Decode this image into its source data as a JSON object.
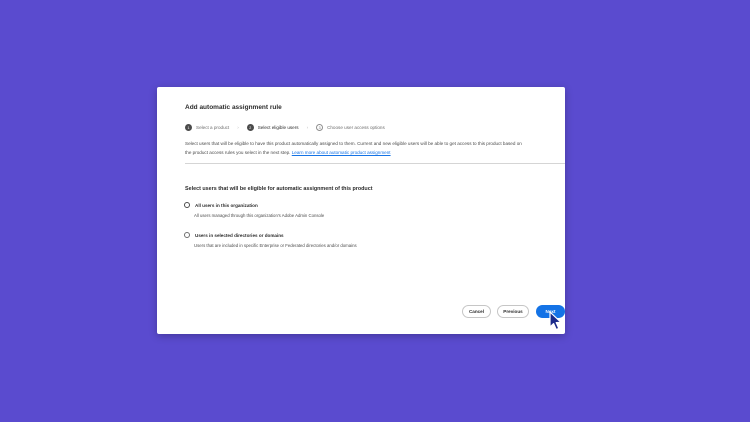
{
  "dialog": {
    "title": "Add automatic assignment rule",
    "steps": [
      {
        "number": "1",
        "label": "Select a product"
      },
      {
        "number": "2",
        "label": "Select eligible users"
      },
      {
        "number": "3",
        "label": "Choose user access options"
      }
    ],
    "step_separator": "›",
    "description_line1": "Select users that will be eligible to have this product automatically assigned to them. Current and new eligible users will be able to get access to this product based on",
    "description_line2": "the product access rules you select in the next step.",
    "learn_more_link": "Learn more about automatic product assignment",
    "section_title": "Select users that will be eligible for automatic assignment of this product",
    "options": [
      {
        "label": "All users in this organization",
        "description": "All users managed through this organization's Adobe Admin Console",
        "selected": true
      },
      {
        "label": "Users in selected directories or domains",
        "description": "Users that are included in specific Enterprise or Federated directories and/or domains",
        "selected": false
      }
    ],
    "buttons": {
      "cancel": "Cancel",
      "previous": "Previous",
      "next": "Next"
    }
  },
  "colors": {
    "background": "#5a4bcf",
    "accent": "#1473e6"
  }
}
